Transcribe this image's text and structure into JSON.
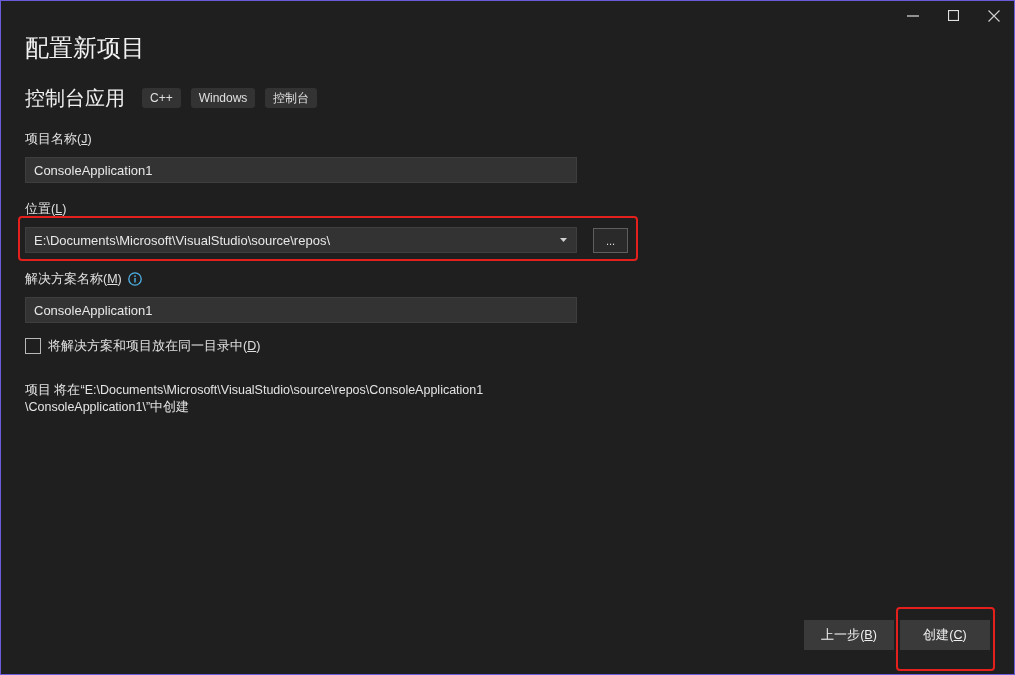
{
  "heading": "配置新项目",
  "template": {
    "name": "控制台应用",
    "tags": [
      "C++",
      "Windows",
      "控制台"
    ]
  },
  "fields": [
    {
      "kind": "text",
      "label": {
        "before": "项目名称(",
        "key": "J",
        "after": ")"
      },
      "value": "ConsoleApplication1"
    },
    {
      "kind": "combo",
      "label": {
        "before": "位置(",
        "key": "L",
        "after": ")"
      },
      "value": "E:\\Documents\\Microsoft\\VisualStudio\\source\\repos\\",
      "browse_label": "...",
      "highlighted": true
    },
    {
      "kind": "text",
      "label": {
        "before": "解决方案名称(",
        "key": "M",
        "after": ")"
      },
      "info": true,
      "value": "ConsoleApplication1"
    },
    {
      "kind": "checkbox",
      "label": {
        "before": "将解决方案和项目放在同一目录中(",
        "key": "D",
        "after": ")"
      },
      "checked": false
    }
  ],
  "summary": [
    "项目 将在“E:\\Documents\\Microsoft\\VisualStudio\\source\\repos\\ConsoleApplication1",
    "\\ConsoleApplication1\\”中创建"
  ],
  "buttons": [
    {
      "label": {
        "before": "上一步(",
        "key": "B",
        "after": ")"
      },
      "highlighted": false
    },
    {
      "label": {
        "before": "创建(",
        "key": "C",
        "after": ")"
      },
      "highlighted": true
    }
  ]
}
